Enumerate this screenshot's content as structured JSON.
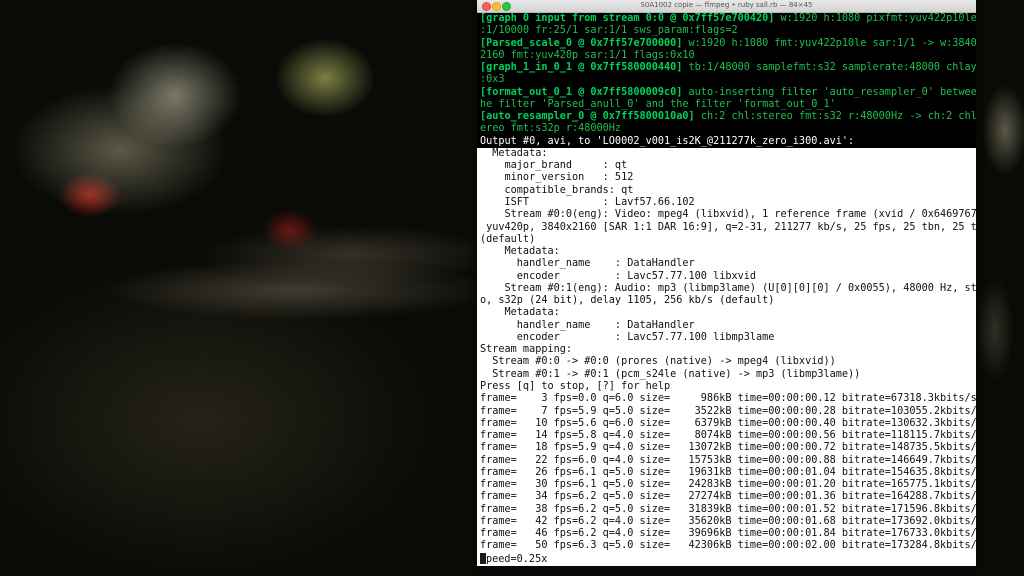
{
  "window": {
    "title": "S0A1002 copie — ffmpeg • ruby sall.rb — 84×45"
  },
  "terminal": {
    "colored_lines": [
      {
        "b": "[graph 0 input from stream 0:0 @ 0x7ff57e700420]",
        "g": " w:1920 h:1080 pixfmt:yuv422p10le tb",
        "w": ""
      },
      {
        "b": "",
        "g": ":1/10000 fr:25/1 sar:1/1 sws_param:flags=2",
        "w": ""
      },
      {
        "b": "[Parsed_scale_0 @ 0x7ff57e700000]",
        "g": " w:1920 h:1080 fmt:yuv422p10le sar:1/1 -> w:3840 h:",
        "w": ""
      },
      {
        "b": "",
        "g": "2160 fmt:yuv420p sar:1/1 flags:0x10",
        "w": ""
      },
      {
        "b": "[graph_1_in_0_1 @ 0x7ff580000440]",
        "g": " tb:1/48000 samplefmt:s32 samplerate:48000 chlayout",
        "w": ""
      },
      {
        "b": "",
        "g": ":0x3",
        "w": ""
      },
      {
        "b": "[format_out_0_1 @ 0x7ff5800009c0]",
        "g": " auto-inserting filter 'auto_resampler_0' between t",
        "w": ""
      },
      {
        "b": "",
        "g": "he filter 'Parsed_anull_0' and the filter 'format_out_0_1'",
        "w": ""
      },
      {
        "b": "[auto_resampler_0 @ 0x7ff5800010a0]",
        "g": " ch:2 chl:stereo fmt:s32 r:48000Hz -> ch:2 chl:st",
        "w": ""
      },
      {
        "b": "",
        "g": "ereo fmt:s32p r:48000Hz",
        "w": ""
      },
      {
        "b": "",
        "g": "",
        "w": "Output #0, avi, to 'LO0002_v001_is2K_@211277k_zero_i300.avi':"
      }
    ],
    "plain_lines": [
      "  Metadata:",
      "    major_brand     : qt",
      "    minor_version   : 512",
      "    compatible_brands: qt",
      "    ISFT            : Lavf57.66.102",
      "    Stream #0:0(eng): Video: mpeg4 (libxvid), 1 reference frame (xvid / 0x64697678),",
      " yuv420p, 3840x2160 [SAR 1:1 DAR 16:9], q=2-31, 211277 kb/s, 25 fps, 25 tbn, 25 tbc",
      "(default)",
      "    Metadata:",
      "      handler_name    : DataHandler",
      "      encoder         : Lavc57.77.100 libxvid",
      "    Stream #0:1(eng): Audio: mp3 (libmp3lame) (U[0][0][0] / 0x0055), 48000 Hz, stere",
      "o, s32p (24 bit), delay 1105, 256 kb/s (default)",
      "    Metadata:",
      "      handler_name    : DataHandler",
      "      encoder         : Lavc57.77.100 libmp3lame",
      "Stream mapping:",
      "  Stream #0:0 -> #0:0 (prores (native) -> mpeg4 (libxvid))",
      "  Stream #0:1 -> #0:1 (pcm_s24le (native) -> mp3 (libmp3lame))",
      "Press [q] to stop, [?] for help",
      "frame=    3 fps=0.0 q=6.0 size=     986kB time=00:00:00.12 bitrate=67318.3kbits/s sp",
      "frame=    7 fps=5.9 q=5.0 size=    3522kB time=00:00:00.28 bitrate=103055.2kbits/s s",
      "frame=   10 fps=5.6 q=6.0 size=    6379kB time=00:00:00.40 bitrate=130632.3kbits/s s",
      "frame=   14 fps=5.8 q=4.0 size=    8074kB time=00:00:00.56 bitrate=118115.7kbits/s s",
      "frame=   18 fps=5.9 q=4.0 size=   13072kB time=00:00:00.72 bitrate=148735.5kbits/s s",
      "frame=   22 fps=6.0 q=4.0 size=   15753kB time=00:00:00.88 bitrate=146649.7kbits/s s",
      "frame=   26 fps=6.1 q=5.0 size=   19631kB time=00:00:01.04 bitrate=154635.8kbits/s s",
      "frame=   30 fps=6.1 q=5.0 size=   24283kB time=00:00:01.20 bitrate=165775.1kbits/s s",
      "frame=   34 fps=6.2 q=5.0 size=   27274kB time=00:00:01.36 bitrate=164288.7kbits/s s",
      "frame=   38 fps=6.2 q=5.0 size=   31839kB time=00:00:01.52 bitrate=171596.8kbits/s s",
      "frame=   42 fps=6.2 q=4.0 size=   35620kB time=00:00:01.68 bitrate=173692.0kbits/s s",
      "frame=   46 fps=6.2 q=4.0 size=   39696kB time=00:00:01.84 bitrate=176733.0kbits/s s",
      "frame=   50 fps=6.3 q=5.0 size=   42306kB time=00:00:02.00 bitrate=173284.8kbits/s s"
    ],
    "cursor_line": "peed=0.25x"
  }
}
